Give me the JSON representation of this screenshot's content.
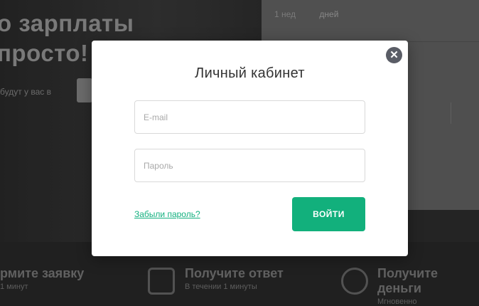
{
  "background": {
    "hero_line1": "о зарплаты",
    "hero_line2": "просто!",
    "hero_sub": "будут у вас в",
    "top_input_left": "1 нед",
    "top_input_right": "дней",
    "steps": [
      {
        "title": "рмите заявку",
        "sub": "1 минут"
      },
      {
        "title": "Получите ответ",
        "sub": "В течении 1 минуты"
      },
      {
        "title": "Получите деньги",
        "sub": "Мгновенно"
      }
    ]
  },
  "modal": {
    "title": "Личный кабинет",
    "email_placeholder": "E-mail",
    "password_placeholder": "Пароль",
    "forgot_link": "Забыли пароль?",
    "submit_label": "ВОЙТИ",
    "close_glyph": "✕"
  }
}
